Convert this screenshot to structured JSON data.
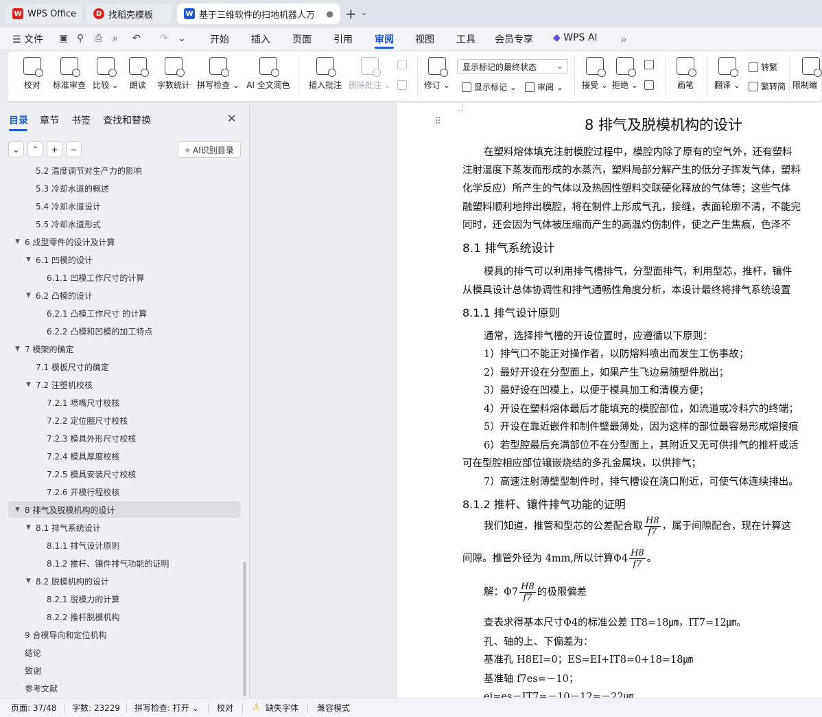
{
  "tabs": [
    {
      "label": "WPS Office",
      "logo": "W"
    },
    {
      "label": "找稻壳模板",
      "logo": "D"
    },
    {
      "label": "基于三维软件的扫地机器人万",
      "logo": "W"
    }
  ],
  "menu": {
    "file": "文件",
    "items": [
      "开始",
      "插入",
      "页面",
      "引用",
      "审阅",
      "视图",
      "工具",
      "会员专享"
    ],
    "active": "审阅",
    "wps_ai": "WPS AI"
  },
  "ribbon": {
    "proof": "校对",
    "standard_review": "标准审查",
    "compare": "比较",
    "read_aloud": "朗读",
    "word_count": "字数统计",
    "spell_check": "拼写检查",
    "ai_polish": "AI 全文润色",
    "insert_comment": "插入批注",
    "delete_comment": "删除批注",
    "revise": "修订",
    "markup_select": "显示标记的最终状态",
    "show_markup": "显示标记",
    "review_pane": "审阅",
    "accept": "接受",
    "reject": "拒绝",
    "pen": "画笔",
    "translate": "翻译",
    "to_traditional": "转繁",
    "to_simplified": "繁转简",
    "restrict_edit": "限制编"
  },
  "nav": {
    "tabs": [
      "目录",
      "章节",
      "书签",
      "查找和替换"
    ],
    "controls": [
      "⌄",
      "⌃",
      "+",
      "−"
    ],
    "ai_button": "AI识别目录",
    "toc": [
      {
        "label": "5.2 温度调节对生产力的影响",
        "level": 2,
        "arrow": false,
        "sel": false
      },
      {
        "label": "5.3 冷却水道的概述",
        "level": 2,
        "arrow": false,
        "sel": false
      },
      {
        "label": "5.4 冷却水道设计",
        "level": 2,
        "arrow": false,
        "sel": false
      },
      {
        "label": "5.5 冷却水道形式",
        "level": 2,
        "arrow": false,
        "sel": false
      },
      {
        "label": "6 成型零件的设计及计算",
        "level": 1,
        "arrow": true,
        "sel": false
      },
      {
        "label": "6.1 凹模的设计",
        "level": 2,
        "arrow": true,
        "sel": false
      },
      {
        "label": "6.1.1 凹模工作尺寸的计算",
        "level": 3,
        "arrow": false,
        "sel": false
      },
      {
        "label": "6.2 凸模的设计",
        "level": 2,
        "arrow": true,
        "sel": false
      },
      {
        "label": "6.2.1 凸模工作尺寸 的计算",
        "level": 3,
        "arrow": false,
        "sel": false
      },
      {
        "label": "6.2.2 凸模和凹模的加工特点",
        "level": 3,
        "arrow": false,
        "sel": false
      },
      {
        "label": "7 模架的确定",
        "level": 1,
        "arrow": true,
        "sel": false
      },
      {
        "label": "7.1 模板尺寸的确定",
        "level": 2,
        "arrow": false,
        "sel": false
      },
      {
        "label": "7.2 注塑机校核",
        "level": 2,
        "arrow": true,
        "sel": false
      },
      {
        "label": "7.2.1 喷嘴尺寸校核",
        "level": 3,
        "arrow": false,
        "sel": false
      },
      {
        "label": "7.2.2 定位圈尺寸校核",
        "level": 3,
        "arrow": false,
        "sel": false
      },
      {
        "label": "7.2.3 模具外形尺寸校核",
        "level": 3,
        "arrow": false,
        "sel": false
      },
      {
        "label": "7.2.4 模具厚度校核",
        "level": 3,
        "arrow": false,
        "sel": false
      },
      {
        "label": "7.2.5 模具安装尺寸校核",
        "level": 3,
        "arrow": false,
        "sel": false
      },
      {
        "label": "7.2.6 开模行程校核",
        "level": 3,
        "arrow": false,
        "sel": false
      },
      {
        "label": "8 排气及脱模机构的设计",
        "level": 1,
        "arrow": true,
        "sel": true
      },
      {
        "label": "8.1 排气系统设计",
        "level": 2,
        "arrow": true,
        "sel": false
      },
      {
        "label": "8.1.1 排气设计原则",
        "level": 3,
        "arrow": false,
        "sel": false
      },
      {
        "label": "8.1.2 推杆、镶件排气功能的证明",
        "level": 3,
        "arrow": false,
        "sel": false
      },
      {
        "label": "8.2 脱模机构的设计",
        "level": 2,
        "arrow": true,
        "sel": false
      },
      {
        "label": "8.2.1 脱模力的计算",
        "level": 3,
        "arrow": false,
        "sel": false
      },
      {
        "label": "8.2.2 推杆脱模机构",
        "level": 3,
        "arrow": false,
        "sel": false
      },
      {
        "label": "9 合模导向和定位机构",
        "level": 1,
        "arrow": false,
        "sel": false
      },
      {
        "label": "结论",
        "level": 1,
        "arrow": false,
        "sel": false
      },
      {
        "label": "致谢",
        "level": 1,
        "arrow": false,
        "sel": false
      },
      {
        "label": "参考文献",
        "level": 1,
        "arrow": false,
        "sel": false
      }
    ]
  },
  "doc": {
    "title": "8  排气及脱模机构的设计",
    "intro": [
      "在塑料熔体填充注射模腔过程中，模腔内除了原有的空气外，还有塑料",
      "注射温度下蒸发而形成的水蒸汽，塑料局部分解产生的低分子挥发气体，塑料",
      "化学反应）所产生的气体以及热固性塑料交联硬化释放的气体等；这些气体",
      "融塑料顺利地排出模腔，将在制件上形成气孔，接缝，表面轮廓不清，不能完",
      "同时，还会因为气体被压缩而产生的高温灼伤制件，使之产生焦痕，色泽不"
    ],
    "h81": "8.1  排气系统设计",
    "p81": [
      "模具的排气可以利用排气槽排气，分型面排气，利用型芯，推杆，镶件",
      "从模具设计总体协调性和排气通畅性角度分析，本设计最终将排气系统设置"
    ],
    "h811": "8.1.1  排气设计原则",
    "p811_intro": "通常，选择排气槽的开设位置时，应遵循以下原则：",
    "rules": [
      "1）排气口不能正对操作者，以防熔料喷出而发生工伤事故；",
      "2）最好开设在分型面上，如果产生飞边易随塑件脱出；",
      "3）最好设在凹模上，以便于模具加工和清模方便；",
      "4）开设在塑料熔体最后才能填充的模腔部位，如流道或冷料穴的终端；",
      "5）开设在靠近嵌件和制件壁最薄处，因为这样的部位最容易形成熔接痕",
      "6）若型腔最后充满部位不在分型面上，其附近又无可供排气的推杆或活",
      "可在型腔相应部位镶嵌烧结的多孔金属块，以供排气；",
      "7）高速注射薄壁型制件时，排气槽设在浇口附近，可使气体连续排出。"
    ],
    "h812": "8.1.2  推杆、镶件排气功能的证明",
    "p812_a_pre": "我们知道，推管和型芯的公差配合取",
    "p812_a_post": "，属于间隙配合，现在计算这",
    "p812_b_pre": "间隙。推管外径为 4mm,所以计算Φ4",
    "p812_b_post": "。",
    "sol_pre": "解：Φ7",
    "sol_post": "的极限偏差",
    "frac_num": "H8",
    "frac_den": "f7",
    "line_lookup": "查表求得基本尺寸Φ4的标准公差 IT8=18㎛，IT7=12㎛。",
    "line_dev": "孔、轴的上、下偏差为：",
    "line_hole": "基准孔 H8EI=0；ES=EI+IT8=0+18=18㎛",
    "line_shaft": "基准轴 f7es=－10；",
    "line_last": "ei=es－IT7=－10－12=－22㎛"
  },
  "status": {
    "page": "页面: 37/48",
    "words": "字数: 23229",
    "spell": "拼写检查: 打开",
    "proof": "校对",
    "missing_font": "缺失字体",
    "compat": "兼容模式"
  },
  "colors": {
    "accent": "#1e5bd6",
    "wps_red": "#e2231a",
    "doc_blue": "#1e5bd6"
  }
}
